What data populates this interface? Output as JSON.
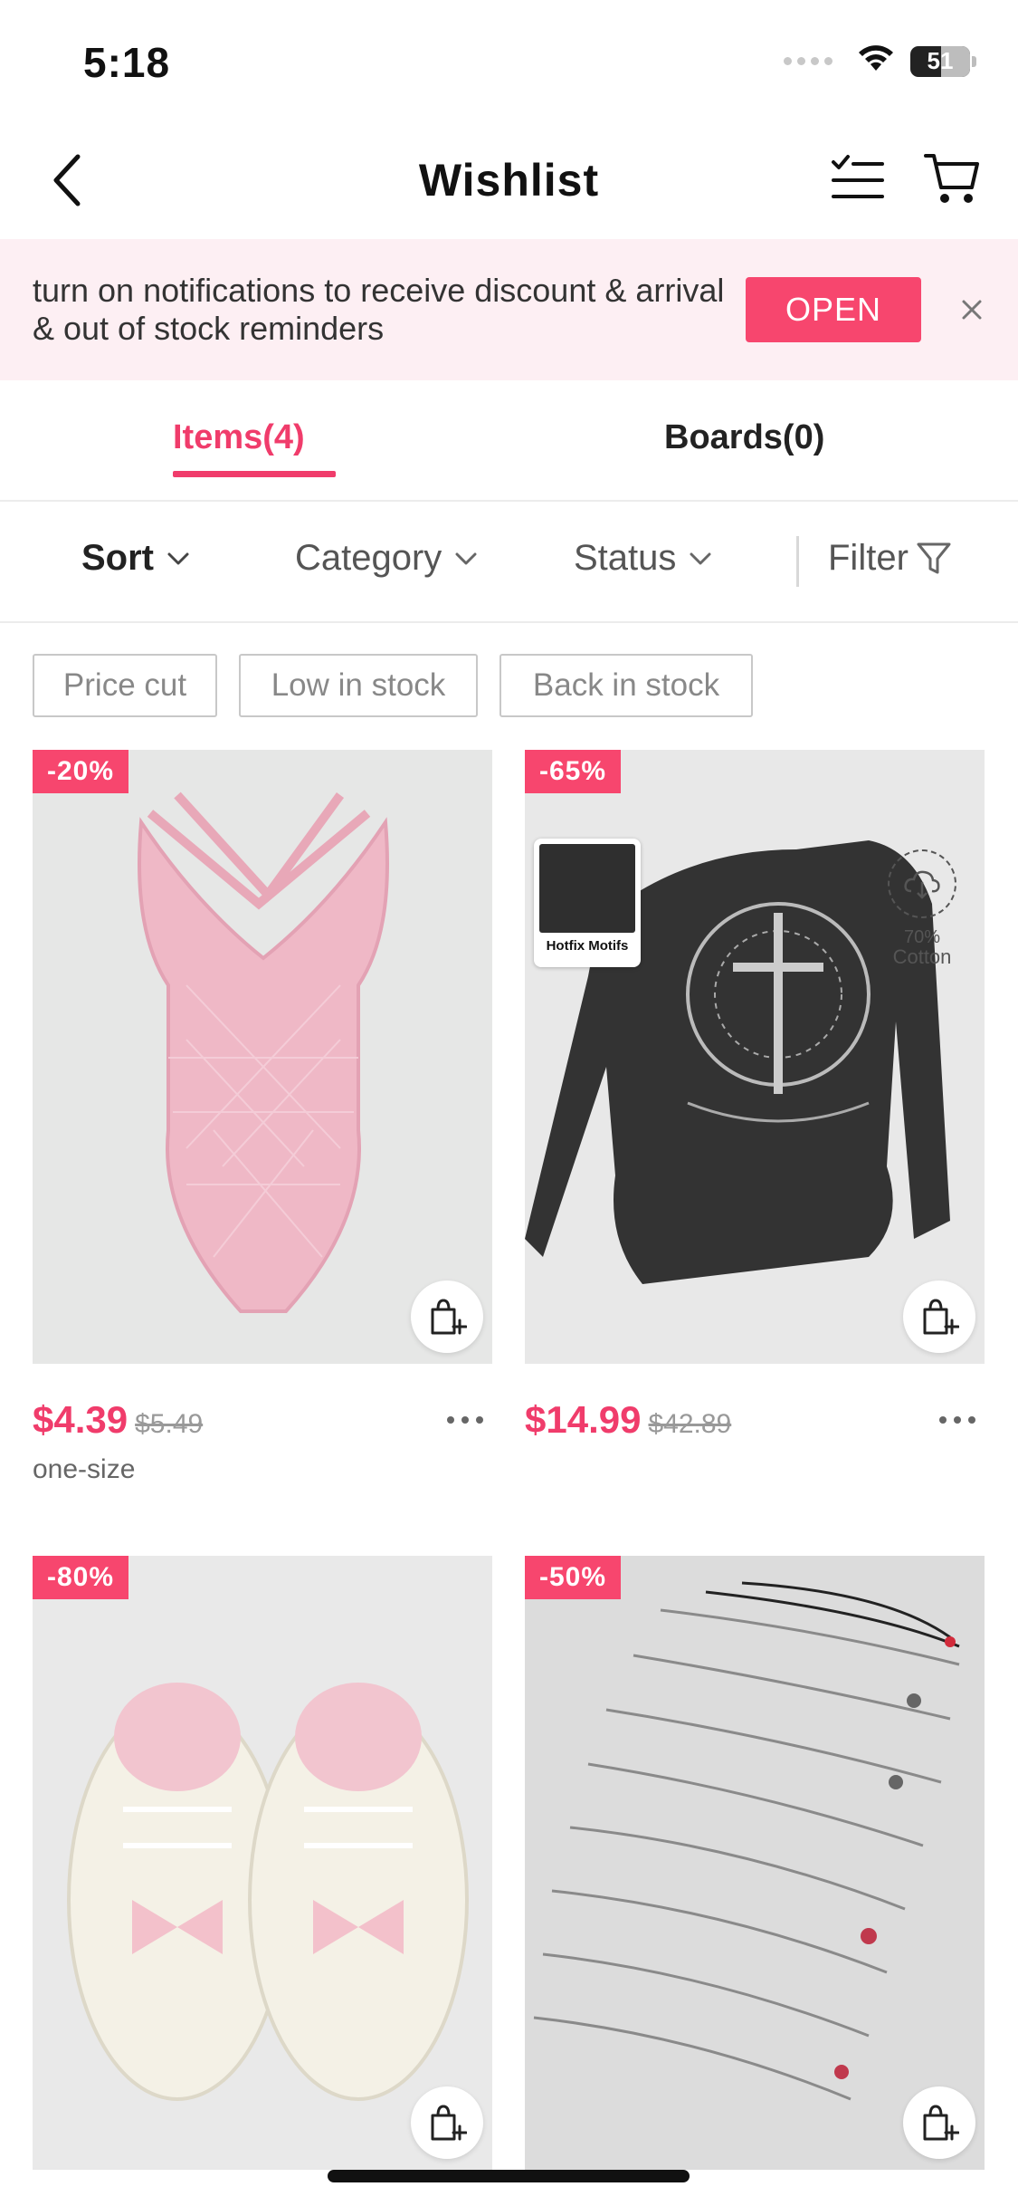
{
  "status_bar": {
    "time": "5:18",
    "battery_level": "51",
    "battery_fraction": 0.51
  },
  "header": {
    "title": "Wishlist",
    "icons": [
      "back-arrow-icon",
      "edit-checklist-icon",
      "cart-icon"
    ]
  },
  "notification": {
    "text": "turn on notifications to receive discount & arrival & out of stock reminders",
    "button_label": "OPEN",
    "close_icon": "close-icon"
  },
  "tabs": [
    {
      "label": "Items(4)",
      "active": true
    },
    {
      "label": "Boards(0)",
      "active": false
    }
  ],
  "filters": {
    "sort": "Sort",
    "category": "Category",
    "status": "Status",
    "filter": "Filter"
  },
  "chips": [
    "Price cut",
    "Low in stock",
    "Back in stock"
  ],
  "products": [
    {
      "discount": "-20%",
      "price": "$4.39",
      "old_price": "$5.49",
      "size": "one-size",
      "image": "pink lace bodysuit"
    },
    {
      "discount": "-65%",
      "price": "$14.99",
      "old_price": "$42.89",
      "badge_label": "Hotfix Motifs",
      "cotton_pct": "70%",
      "cotton_label": "Cotton",
      "image": "black off-shoulder long sleeve top"
    },
    {
      "discount": "-80%",
      "image": "cream sneakers with pink bows"
    },
    {
      "discount": "-50%",
      "image": "silver chain necklaces set"
    }
  ],
  "colors": {
    "accent": "#f03c6b",
    "button": "#f7466e",
    "banner_bg": "#fdeff3"
  }
}
